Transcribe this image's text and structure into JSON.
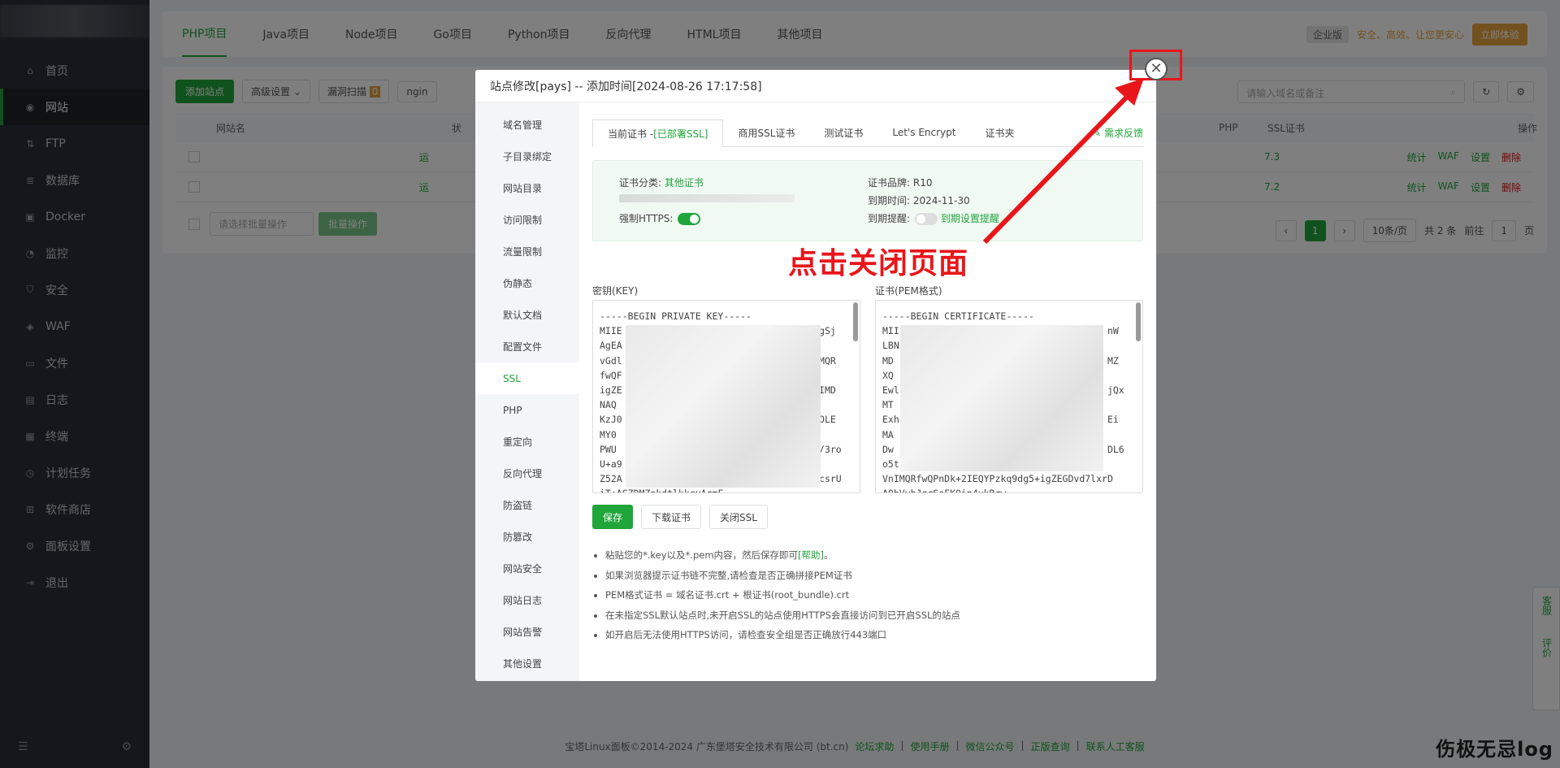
{
  "sidebar": {
    "items": [
      {
        "label": "首页",
        "icon": "home-icon"
      },
      {
        "label": "网站",
        "icon": "globe-icon"
      },
      {
        "label": "FTP",
        "icon": "ftp-icon"
      },
      {
        "label": "数据库",
        "icon": "database-icon"
      },
      {
        "label": "Docker",
        "icon": "docker-icon"
      },
      {
        "label": "监控",
        "icon": "monitor-icon"
      },
      {
        "label": "安全",
        "icon": "shield-icon"
      },
      {
        "label": "WAF",
        "icon": "waf-icon"
      },
      {
        "label": "文件",
        "icon": "folder-icon"
      },
      {
        "label": "日志",
        "icon": "log-icon"
      },
      {
        "label": "终端",
        "icon": "terminal-icon"
      },
      {
        "label": "计划任务",
        "icon": "clock-icon"
      },
      {
        "label": "软件商店",
        "icon": "store-icon"
      },
      {
        "label": "面板设置",
        "icon": "gear-icon"
      },
      {
        "label": "退出",
        "icon": "logout-icon"
      }
    ],
    "active_index": 1
  },
  "project_tabs": [
    "PHP项目",
    "Java项目",
    "Node项目",
    "Go项目",
    "Python项目",
    "反向代理",
    "HTML项目",
    "其他项目"
  ],
  "topright": {
    "badge": "企业版",
    "slogan": "安全、高效、让您更安心",
    "try_label": "立即体验"
  },
  "toolbar": {
    "add_site": "添加站点",
    "advanced": "高级设置",
    "vuln_scan": "漏洞扫描",
    "vuln_count": "0",
    "nginx": "ngin",
    "search_placeholder": "请输入域名或备注"
  },
  "table": {
    "headers": {
      "site_name": "网站名",
      "status": "状",
      "php": "PHP",
      "ssl": "SSL证书",
      "ops": "操作"
    },
    "rows": [
      {
        "status": "运",
        "php": "7.3",
        "links": [
          "统计",
          "WAF",
          "设置",
          "删除"
        ]
      },
      {
        "status": "运",
        "php": "7.2",
        "links": [
          "统计",
          "WAF",
          "设置",
          "删除"
        ]
      }
    ],
    "batch_placeholder": "请选择批量操作",
    "batch_btn": "批量操作"
  },
  "pager": {
    "current": "1",
    "per_page": "10条/页",
    "total": "共 2 条",
    "goto_label": "前往",
    "goto_value": "1",
    "page_unit": "页"
  },
  "footer": {
    "copyright": "宝塔Linux面板©2014-2024 广东堡塔安全技术有限公司 (bt.cn)",
    "links": [
      "论坛求助",
      "使用手册",
      "微信公众号",
      "正版查询",
      "联系人工客服"
    ]
  },
  "service": {
    "kefu": "客服",
    "pingjia": "评价"
  },
  "watermark": "伤极无忌log",
  "modal": {
    "title": "站点修改[pays] -- 添加时间[2024-08-26 17:17:58]",
    "nav": [
      "域名管理",
      "子目录绑定",
      "网站目录",
      "访问限制",
      "流量限制",
      "伪静态",
      "默认文档",
      "配置文件",
      "SSL",
      "PHP",
      "重定向",
      "反向代理",
      "防盗链",
      "防篡改",
      "网站安全",
      "网站日志",
      "网站告警",
      "其他设置"
    ],
    "nav_active": 8,
    "cert_tabs": {
      "current_prefix": "当前证书 - ",
      "current_status": "[已部署SSL]",
      "others": [
        "商用SSL证书",
        "测试证书",
        "Let's Encrypt",
        "证书夹"
      ],
      "feedback": "需求反馈"
    },
    "info": {
      "category_label": "证书分类:",
      "category_value": "其他证书",
      "https_label": "强制HTTPS:",
      "brand_label": "证书品牌:",
      "brand_value": "R10",
      "expire_label": "到期时间:",
      "expire_value": "2024-11-30",
      "remind_label": "到期提醒:",
      "remind_link": "到期设置提醒"
    },
    "key_label": "密钥(KEY)",
    "cert_label": "证书(PEM格式)",
    "key_lines": [
      "-----BEGIN PRIVATE KEY-----",
      "MIIE                                   gSj",
      "AgEA",
      "vGdl                                   MQR",
      "fwQF",
      "igZE                                   IMD",
      "NAQ",
      "KzJ0                                   OLE",
      "MY0",
      "PWU                                    /3ro",
      "U+a9",
      "Z52A                                   csrU",
      "iT+AGZDMZokdtlkkruArmF"
    ],
    "cert_lines": [
      "-----BEGIN CERTIFICATE-----",
      "MII                                     nW",
      "LBN",
      "MD                                      MZ",
      "XQ",
      "Ewl                                     jQx",
      "MT",
      "Exh                                     Ei",
      "MA",
      "Dw                                      DL6",
      "o5t",
      "VnIMQRfwQPnDk+2IEQYPzkq9dg5+igZEGDvd7lxrD",
      "A0bVybJgrSeFK0in4ykBrw"
    ],
    "buttons": {
      "save": "保存",
      "download": "下载证书",
      "close_ssl": "关闭SSL"
    },
    "tips": [
      {
        "text": "粘贴您的*.key以及*.pem内容，然后保存即可",
        "link": "[帮助]",
        "tail": "。"
      },
      {
        "text": "如果浏览器提示证书链不完整,请检查是否正确拼接PEM证书"
      },
      {
        "text": "PEM格式证书 = 域名证书.crt + 根证书(root_bundle).crt"
      },
      {
        "text": "在未指定SSL默认站点时,未开启SSL的站点使用HTTPS会直接访问到已开启SSL的站点"
      },
      {
        "text": "如开启后无法使用HTTPS访问，请检查安全组是否正确放行443端口"
      }
    ]
  },
  "annotation": {
    "text": "点击关闭页面",
    "color": "#e8161a"
  },
  "colors": {
    "accent": "#20a53a",
    "danger": "#ef0808",
    "annotation": "#e8161a",
    "sidebar_bg": "#2b2f38"
  }
}
